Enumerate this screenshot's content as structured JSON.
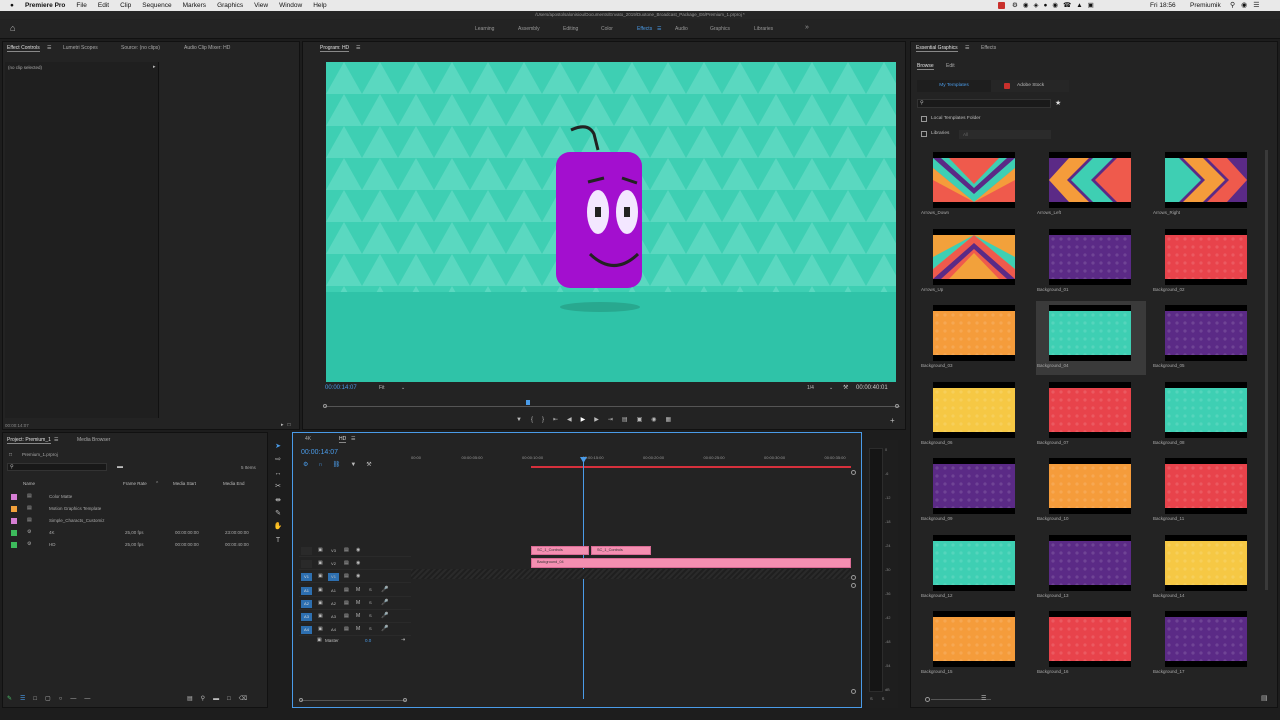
{
  "menubar": {
    "apple": "",
    "app": "Premiere Pro",
    "items": [
      "File",
      "Edit",
      "Clip",
      "Sequence",
      "Markers",
      "Graphics",
      "View",
      "Window",
      "Help"
    ],
    "time": "Fri 18:56",
    "user": "Premiumik"
  },
  "title": "/Users/apostolsalonisiou/Documents/Envato_2019/Duotone_Broadcast_Package_E6/Premium_1.prproj *",
  "workspaces": [
    "Learning",
    "Assembly",
    "Editing",
    "Color",
    "Effects",
    "Audio",
    "Graphics",
    "Libraries"
  ],
  "workspace_active": "Effects",
  "source_panel": {
    "tabs": [
      "Effect Controls",
      "Lumetri Scopes",
      "Source: (no clips)",
      "Audio Clip Mixer: HD"
    ],
    "no_clip": "(no clip selected)",
    "timecode": "00:00:14:07"
  },
  "program": {
    "tab": "Program: HD",
    "timecode": "00:00:14:07",
    "fit": "Fit",
    "ratio": "1/4",
    "duration": "00:00:40:01",
    "bg": "#3ecfb3",
    "character": "#a30fcf"
  },
  "project": {
    "tabs": [
      "Project: Premium_1",
      "Media Browser"
    ],
    "file": "Premium_1.prproj",
    "items_count": "5 Items",
    "columns": [
      "Name",
      "Frame Rate",
      "Media Start",
      "Media End"
    ],
    "rows": [
      {
        "name": "Color Matte",
        "rate": "",
        "start": "",
        "end": "",
        "color": "#d67ed4"
      },
      {
        "name": "Motion Graphics Template",
        "rate": "",
        "start": "",
        "end": "",
        "color": "#f2a13b"
      },
      {
        "name": "Simple_Characts_Customiz",
        "rate": "",
        "start": "",
        "end": "",
        "color": "#d67ed4"
      },
      {
        "name": "4K",
        "rate": "25,00 fps",
        "start": "00:00:00:00",
        "end": "23:00:00:00",
        "color": "#3dbb5c"
      },
      {
        "name": "HD",
        "rate": "25,00 fps",
        "start": "00:00:00:00",
        "end": "00:00:40:00",
        "color": "#3dbb5c"
      }
    ]
  },
  "timeline": {
    "tabs": [
      "4K",
      "HD"
    ],
    "timecode": "00:00:14:07",
    "ruler": [
      "00:00",
      "00:00:05:00",
      "00:00:10:00",
      "00:00:15:00",
      "00:00:20:00",
      "00:00:25:00",
      "00:00:30:00",
      "00:00:35:00"
    ],
    "tracks": [
      "V3",
      "V2",
      "V1",
      "A1",
      "A2",
      "A3",
      "A4"
    ],
    "master": "Master",
    "master_val": "0.0",
    "clips": [
      {
        "label": "SC_1_Controls",
        "track": "V3"
      },
      {
        "label": "SC_1_Controls",
        "track": "V3"
      },
      {
        "label": "Background_04",
        "track": "V2"
      }
    ]
  },
  "meter_scale": [
    "0",
    "-6",
    "-12",
    "-18",
    "-24",
    "-30",
    "-36",
    "-42",
    "-48",
    "-54",
    "dB"
  ],
  "essential": {
    "tabs": [
      "Essential Graphics",
      "Effects"
    ],
    "subtabs": [
      "Browse",
      "Edit"
    ],
    "my_templates": "My Templates",
    "adobe_stock": "Adobe Stock",
    "local_folder": "Local Templates Folder",
    "libraries": "Libraries",
    "libraries_value": "All",
    "templates": [
      {
        "name": "Arrows_Down",
        "color": "#ef5a4c",
        "kind": "arrowdown"
      },
      {
        "name": "Arrows_Left",
        "color": "#5b2a86",
        "kind": "arrowleft"
      },
      {
        "name": "Arrows_Right",
        "color": "#5b2a86",
        "kind": "arrowright"
      },
      {
        "name": "Arrows_Up",
        "color": "#f2a13b",
        "kind": "arrowup"
      },
      {
        "name": "Background_01",
        "color": "#5b2a86",
        "kind": "bg"
      },
      {
        "name": "Background_02",
        "color": "#e8434b",
        "kind": "bg"
      },
      {
        "name": "Background_03",
        "color": "#f59c3b",
        "kind": "bg"
      },
      {
        "name": "Background_04",
        "color": "#3ecfb3",
        "kind": "bg",
        "selected": true
      },
      {
        "name": "Background_05",
        "color": "#5b2a86",
        "kind": "bg"
      },
      {
        "name": "Background_06",
        "color": "#f6c844",
        "kind": "bg"
      },
      {
        "name": "Background_07",
        "color": "#e8434b",
        "kind": "bg"
      },
      {
        "name": "Background_08",
        "color": "#3ecfb3",
        "kind": "bg"
      },
      {
        "name": "Background_09",
        "color": "#5b2a86",
        "kind": "bg"
      },
      {
        "name": "Background_10",
        "color": "#f59c3b",
        "kind": "bg"
      },
      {
        "name": "Background_11",
        "color": "#e8434b",
        "kind": "bg"
      },
      {
        "name": "Background_12",
        "color": "#3ecfb3",
        "kind": "bg"
      },
      {
        "name": "Background_13",
        "color": "#5b2a86",
        "kind": "bg"
      },
      {
        "name": "Background_14",
        "color": "#f6c844",
        "kind": "bg"
      },
      {
        "name": "Background_15",
        "color": "#f59c3b",
        "kind": "bg"
      },
      {
        "name": "Background_16",
        "color": "#e8434b",
        "kind": "bg"
      },
      {
        "name": "Background_17",
        "color": "#5b2a86",
        "kind": "bg"
      }
    ]
  },
  "accent": "#4a9be8"
}
